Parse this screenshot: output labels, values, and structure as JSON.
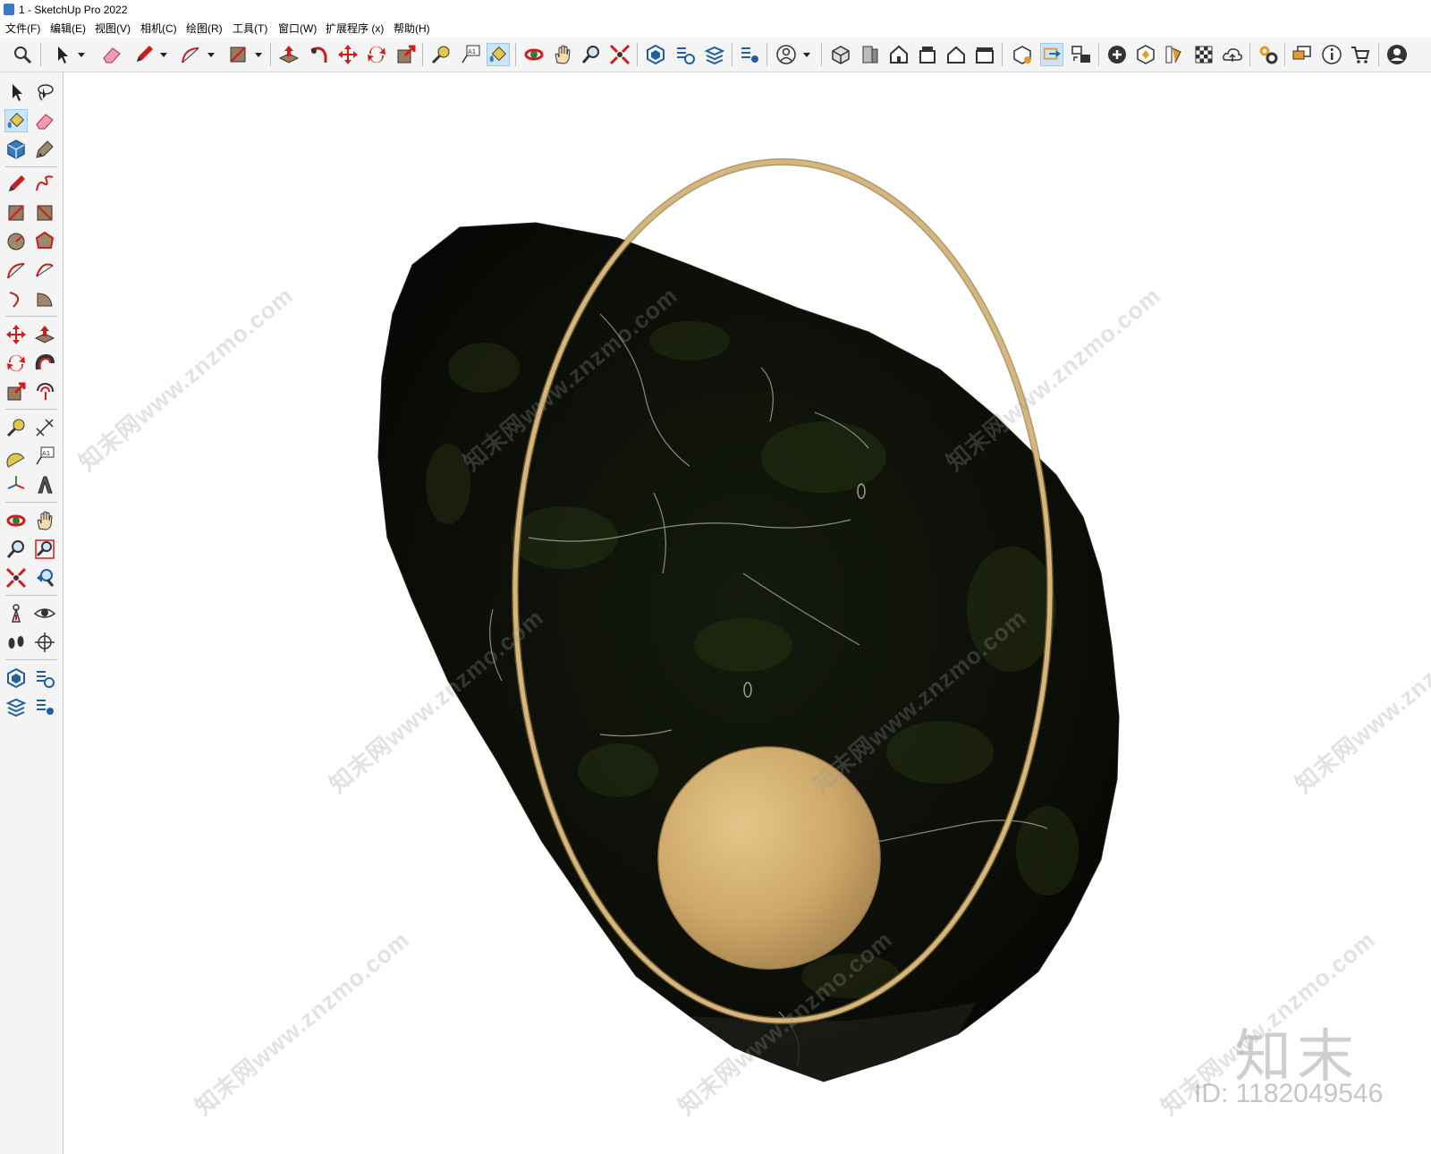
{
  "window": {
    "title": "1 - SketchUp Pro 2022"
  },
  "menu": [
    {
      "id": "file",
      "label": "文件(F)"
    },
    {
      "id": "edit",
      "label": "编辑(E)"
    },
    {
      "id": "view",
      "label": "视图(V)"
    },
    {
      "id": "camera",
      "label": "相机(C)"
    },
    {
      "id": "draw",
      "label": "绘图(R)"
    },
    {
      "id": "tools",
      "label": "工具(T)"
    },
    {
      "id": "window",
      "label": "窗口(W)"
    },
    {
      "id": "extensions",
      "label": "扩展程序 (x)"
    },
    {
      "id": "help",
      "label": "帮助(H)"
    }
  ],
  "toolbar": {
    "top_tools": [
      "search-icon",
      "select-icon",
      "eraser-icon",
      "pencil-icon",
      "arc-icon",
      "rectangle-icon",
      "push-pull-icon",
      "follow-me-icon",
      "move-icon",
      "rotate-icon",
      "scale-icon",
      "tape-measure-icon",
      "text-icon",
      "paint-bucket-icon",
      "orbit-icon",
      "pan-icon",
      "zoom-icon",
      "zoom-extents-icon",
      "warehouse-icon",
      "extension-warehouse-icon",
      "layout-icon",
      "model-info-icon",
      "user-icon",
      "iso-view-icon",
      "top-view-icon",
      "front-view-icon",
      "right-view-icon",
      "back-view-icon",
      "left-view-icon",
      "solid-tools-icon",
      "section-plane-icon",
      "scenes-icon",
      "add-location-icon",
      "sandbox-icon",
      "styles-icon",
      "shadows-icon",
      "cloud-icon",
      "settings-icon",
      "message-icon",
      "info-icon",
      "cart-icon",
      "account-icon"
    ],
    "active_top": "paint-bucket-icon",
    "active_left": "paint-bucket-icon"
  },
  "scene": {
    "rock_color": "#0b0d08",
    "ring_color": "#d6b67a",
    "sphere_color": "#d4b06e"
  },
  "watermark": {
    "text": "知末网www.znzmo.com",
    "logo": "知末",
    "id": "ID: 1182049546"
  }
}
